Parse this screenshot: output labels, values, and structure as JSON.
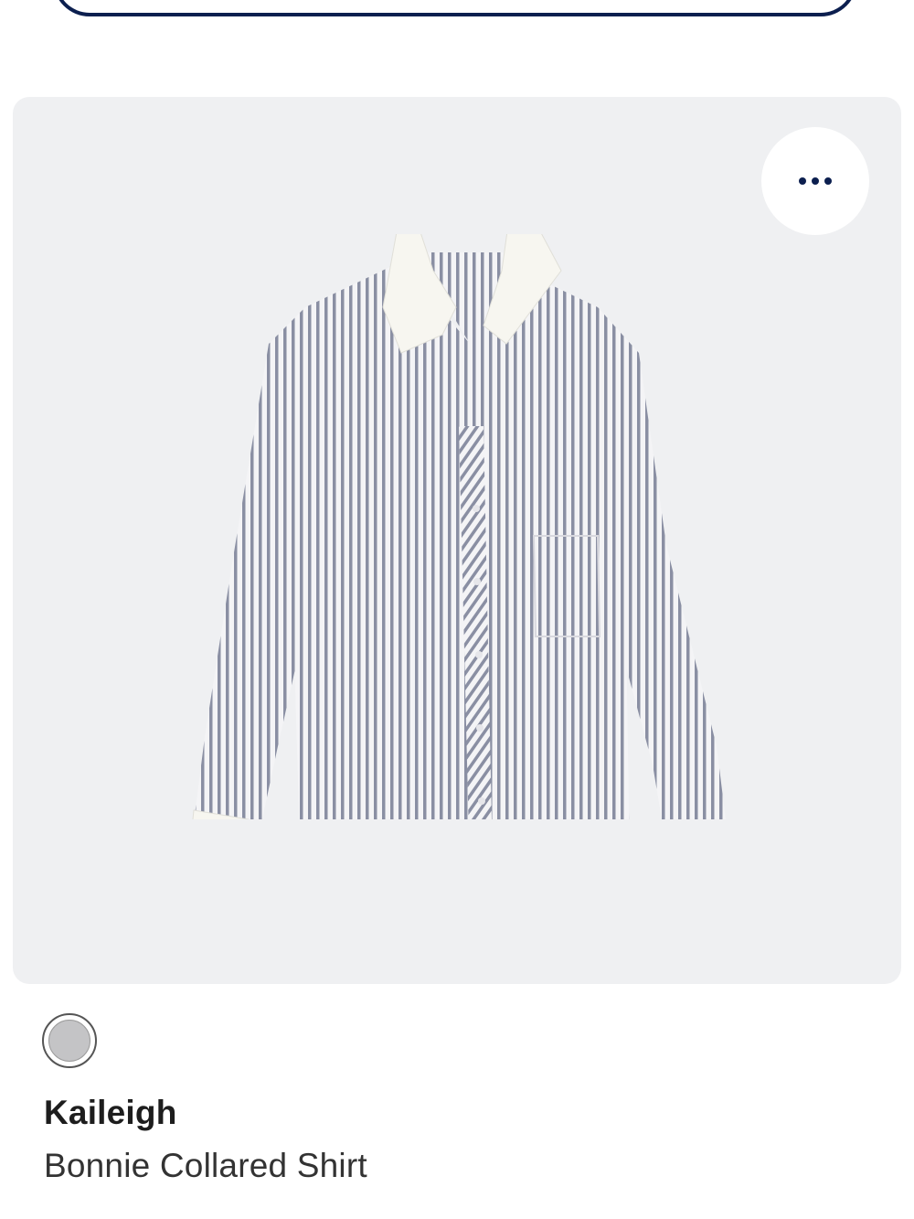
{
  "product": {
    "brand": "Kaileigh",
    "name": "Bonnie Collared Shirt",
    "image_icon": "striped-collared-shirt",
    "swatch_color": "#c4c4c6"
  },
  "actions": {
    "more_icon": "ellipsis-icon"
  },
  "colors": {
    "accent": "#0c1f4f",
    "card_background": "#eff0f2"
  }
}
